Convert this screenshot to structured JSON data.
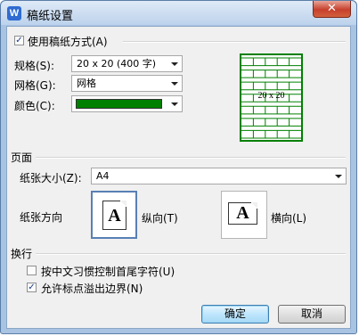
{
  "window": {
    "title": "稿纸设置",
    "app_icon_letter": "W",
    "close_glyph": "✕"
  },
  "use_manuscript": {
    "checked": true,
    "label": "使用稿纸方式(A)"
  },
  "spec": {
    "label": "规格(S):",
    "value": "20 x 20 (400 字)"
  },
  "grid": {
    "label": "网格(G):",
    "value": "网格"
  },
  "color": {
    "label": "颜色(C):",
    "value": "#008000"
  },
  "preview": {
    "text": "20 x 20",
    "line_color": "#008000"
  },
  "page": {
    "heading": "页面",
    "size_label": "纸张大小(Z):",
    "size_value": "A4",
    "orientation_label": "纸张方向",
    "portrait_label": "纵向(T)",
    "landscape_label": "横向(L)",
    "portrait_glyph": "A",
    "landscape_glyph": "A",
    "selected": "portrait"
  },
  "line_break": {
    "heading": "换行",
    "option1": {
      "checked": false,
      "label": "按中文习惯控制首尾字符(U)"
    },
    "option2": {
      "checked": true,
      "label": "允许标点溢出边界(N)"
    }
  },
  "buttons": {
    "ok": "确定",
    "cancel": "取消"
  }
}
